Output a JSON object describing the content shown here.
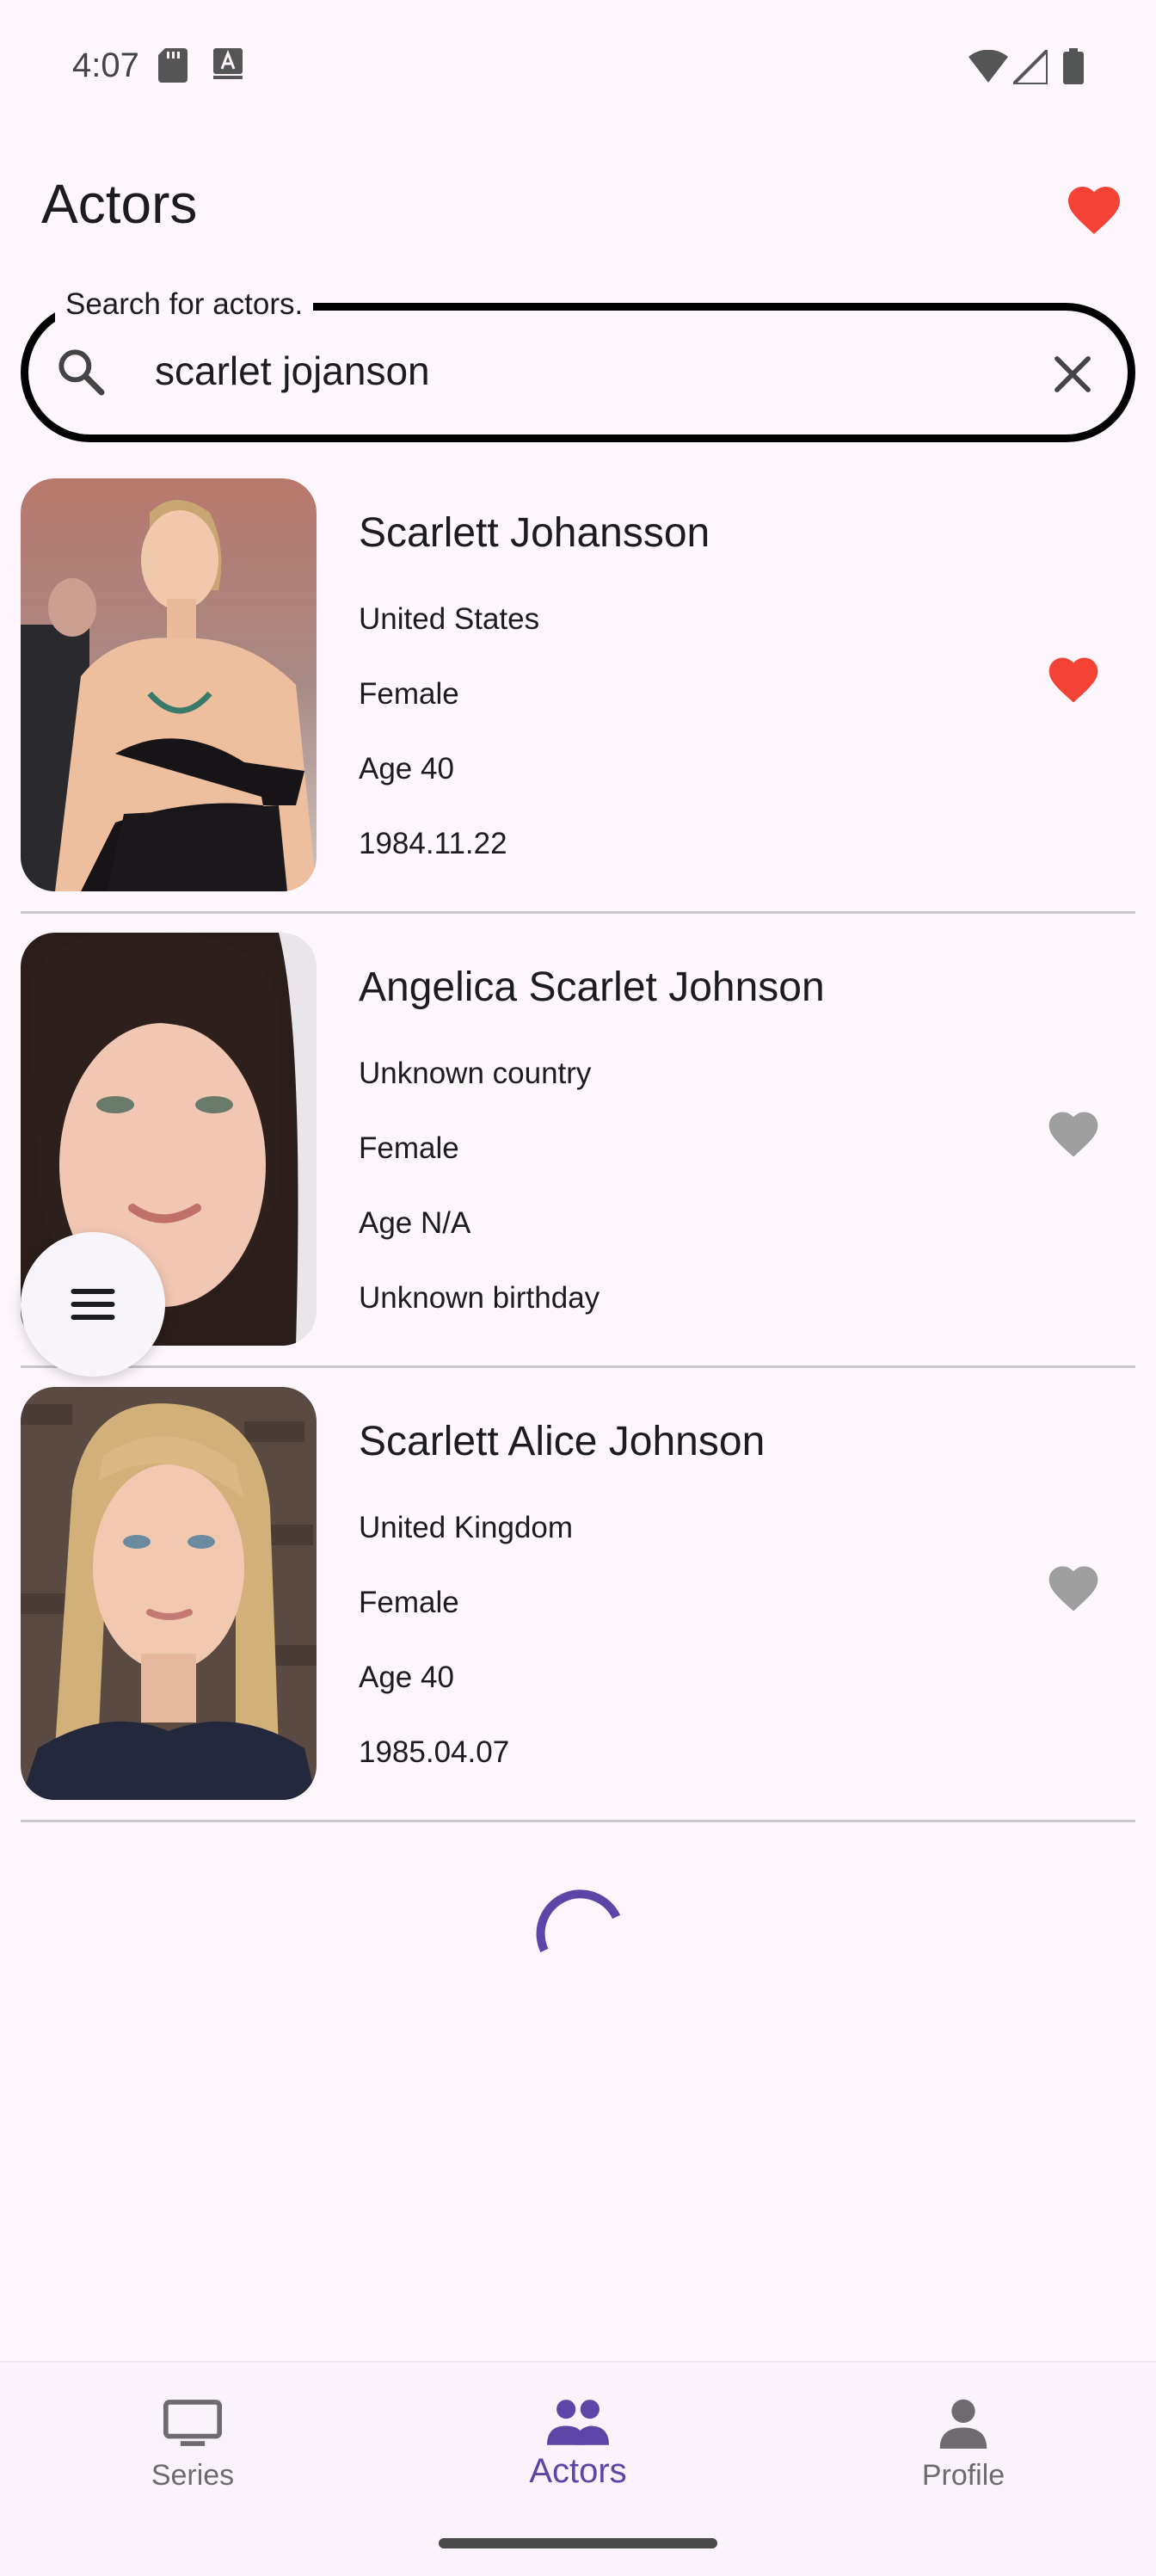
{
  "status_bar": {
    "time": "4:07"
  },
  "app_bar": {
    "title": "Actors"
  },
  "search": {
    "label": "Search for actors.",
    "value": "scarlet jojanson"
  },
  "actors": [
    {
      "name": "Scarlett Johansson",
      "country": "United States",
      "gender": "Female",
      "age": "Age 40",
      "birthday": "1984.11.22",
      "favorite": true
    },
    {
      "name": "Angelica Scarlet Johnson",
      "country": "Unknown country",
      "gender": "Female",
      "age": "Age N/A",
      "birthday": "Unknown birthday",
      "favorite": false
    },
    {
      "name": "Scarlett Alice Johnson",
      "country": "United Kingdom",
      "gender": "Female",
      "age": "Age 40",
      "birthday": "1985.04.07",
      "favorite": false
    }
  ],
  "bottom_nav": {
    "items": [
      {
        "label": "Series",
        "icon": "tv-icon"
      },
      {
        "label": "Actors",
        "icon": "people-icon",
        "active": true
      },
      {
        "label": "Profile",
        "icon": "person-icon"
      }
    ]
  },
  "colors": {
    "background": "#fdf7fd",
    "favorite_active": "#f44336",
    "favorite_inactive": "#9e9e9e",
    "accent": "#5b46a8"
  }
}
